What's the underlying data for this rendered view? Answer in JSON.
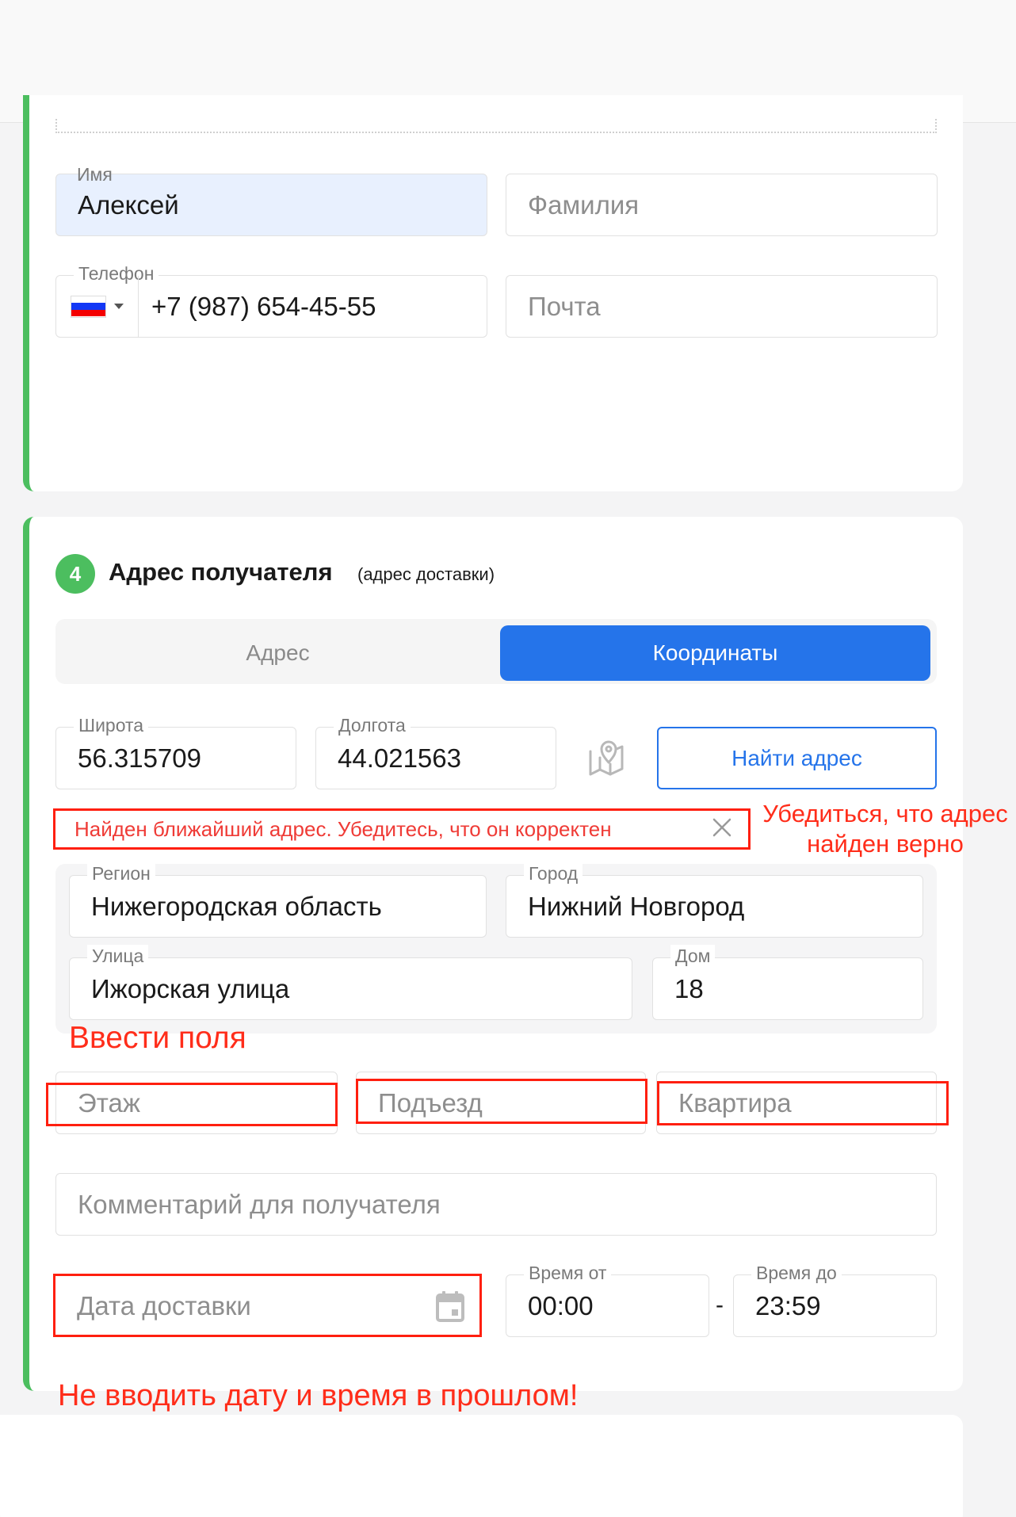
{
  "recipient": {
    "first_name": {
      "label": "Имя",
      "value": "Алексей"
    },
    "last_name": {
      "placeholder": "Фамилия"
    },
    "phone": {
      "label": "Телефон",
      "value": "+7 (987) 654-45-55",
      "country_flag": "russia-flag-icon"
    },
    "email": {
      "placeholder": "Почта"
    }
  },
  "address_section": {
    "step_number": "4",
    "title": "Адрес получателя",
    "subtitle": "(адрес доставки)",
    "tabs": [
      {
        "label": "Адрес",
        "active": false
      },
      {
        "label": "Координаты",
        "active": true
      }
    ],
    "latitude": {
      "label": "Широта",
      "value": "56.315709"
    },
    "longitude": {
      "label": "Долгота",
      "value": "44.021563"
    },
    "map_icon": "map-pin-icon",
    "find_button": "Найти адрес",
    "notice": "Найден ближайший адрес. Убедитесь, что он корректен",
    "region": {
      "label": "Регион",
      "value": "Нижегородская область"
    },
    "city": {
      "label": "Город",
      "value": "Нижний Новгород"
    },
    "street": {
      "label": "Улица",
      "value": "Ижорская улица"
    },
    "house": {
      "label": "Дом",
      "value": "18"
    },
    "floor": {
      "placeholder": "Этаж"
    },
    "entrance": {
      "placeholder": "Подъезд"
    },
    "apartment": {
      "placeholder": "Квартира"
    },
    "comment": {
      "placeholder": "Комментарий для получателя"
    },
    "delivery_date": {
      "placeholder": "Дата доставки"
    },
    "time_from": {
      "label": "Время от",
      "value": "00:00"
    },
    "time_separator": "-",
    "time_to": {
      "label": "Время до",
      "value": "23:59"
    }
  },
  "annotations": {
    "check_address": "Убедиться, что адрес\nнайден верно",
    "enter_fields": "Ввести поля",
    "no_past_date": "Не вводить дату и время в прошлом!"
  },
  "colors": {
    "accent_blue": "#2574ea",
    "step_green": "#4cbe5f",
    "annotation_red": "#ff1f0f",
    "autofill_bg": "#e8f0fe"
  }
}
